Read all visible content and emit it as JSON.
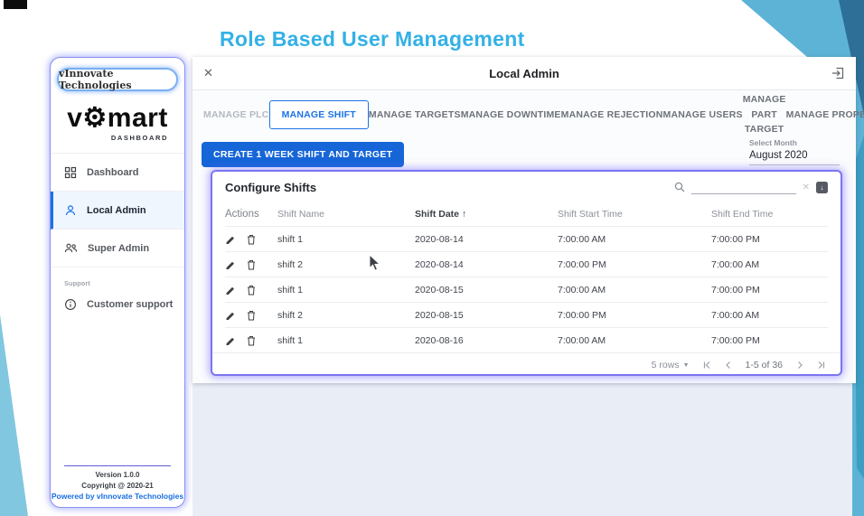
{
  "slide": {
    "title": "Role Based User Management"
  },
  "sidebar": {
    "logo_text": "vInnovate Technologies",
    "brand": {
      "prefix": "v",
      "gear": "⚙",
      "suffix": "mart",
      "subtitle": "DASHBOARD"
    },
    "items": [
      {
        "label": "Dashboard",
        "icon": "grid-icon",
        "active": false
      },
      {
        "label": "Local Admin",
        "icon": "person-icon",
        "active": true
      },
      {
        "label": "Super Admin",
        "icon": "people-icon",
        "active": false
      }
    ],
    "support_label": "Support",
    "support_item": {
      "label": "Customer support",
      "icon": "info-icon"
    },
    "footer": {
      "version": "Version 1.0.0",
      "copyright": "Copyright @ 2020-21",
      "powered": "Powered by vInnovate Technologies"
    }
  },
  "window": {
    "title": "Local Admin",
    "close_glyph": "✕",
    "tabs": [
      "MANAGE PLC",
      "MANAGE SHIFT",
      "MANAGE TARGETS",
      "MANAGE DOWNTIME",
      "MANAGE REJECTION",
      "MANAGE USERS",
      "MANAGE PART TARGET",
      "MANAGE PROPERTY"
    ],
    "active_tab": "MANAGE SHIFT",
    "create_button": "CREATE 1 WEEK SHIFT AND TARGET",
    "month_label": "Select Month",
    "month_value": "August 2020",
    "table": {
      "title": "Configure Shifts",
      "search_value": "",
      "clear_glyph": "✕",
      "columns": {
        "actions": "Actions",
        "name": "Shift Name",
        "date": "Shift Date",
        "sort_arrow": "↑",
        "start": "Shift Start Time",
        "end": "Shift End Time"
      },
      "rows": [
        {
          "name": "shift 1",
          "date": "2020-08-14",
          "start": "7:00:00 AM",
          "end": "7:00:00 PM"
        },
        {
          "name": "shift 2",
          "date": "2020-08-14",
          "start": "7:00:00 PM",
          "end": "7:00:00 AM"
        },
        {
          "name": "shift 1",
          "date": "2020-08-15",
          "start": "7:00:00 AM",
          "end": "7:00:00 PM"
        },
        {
          "name": "shift 2",
          "date": "2020-08-15",
          "start": "7:00:00 PM",
          "end": "7:00:00 AM"
        },
        {
          "name": "shift 1",
          "date": "2020-08-16",
          "start": "7:00:00 AM",
          "end": "7:00:00 PM"
        }
      ],
      "pagination": {
        "rows_per_page": "5 rows",
        "caret": "▼",
        "range": "1-5 of 36"
      }
    }
  },
  "colors": {
    "accent_blue": "#1a73e8",
    "button_blue": "#1666d8",
    "title_cyan": "#33b1e6",
    "glow_purple": "#7c74f0",
    "teal_light": "#5db3d6",
    "teal_dark": "#2e6f97",
    "panel_gray": "#e9eef6"
  }
}
